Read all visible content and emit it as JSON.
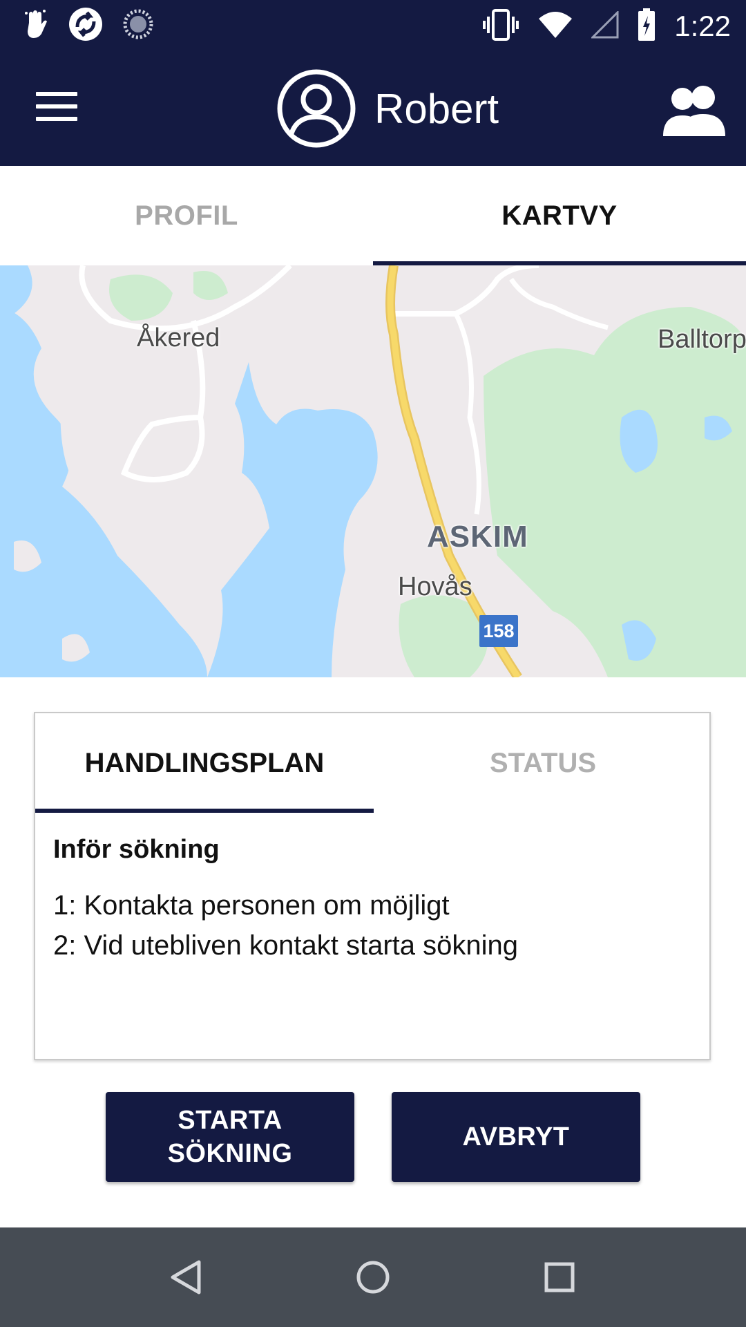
{
  "status_bar": {
    "time": "1:22",
    "left_icons": [
      "hand-wave-icon",
      "circular-arrows-icon",
      "loading-spinner-icon"
    ],
    "right_icons": [
      "vibrate-icon",
      "wifi-icon",
      "signal-icon",
      "battery-charging-icon"
    ]
  },
  "app_bar": {
    "user_name": "Robert",
    "menu_icon": "hamburger-menu-icon",
    "avatar_icon": "user-avatar-icon",
    "group_icon": "group-people-icon"
  },
  "tabs": [
    {
      "label": "PROFIL",
      "active": false
    },
    {
      "label": "KARTVY",
      "active": true
    }
  ],
  "map": {
    "labels": {
      "akered": "Åkered",
      "balltorp": "Balltorp",
      "askim": "ASKIM",
      "hovas": "Hovås"
    },
    "road_badge": "158"
  },
  "card": {
    "tabs": [
      {
        "label": "HANDLINGSPLAN",
        "active": true
      },
      {
        "label": "STATUS",
        "active": false
      }
    ],
    "heading": "Inför sökning",
    "lines": [
      "1: Kontakta personen om möjligt",
      "2: Vid utebliven kontakt starta sökning"
    ]
  },
  "buttons": {
    "start_line1": "STARTA",
    "start_line2": "SÖKNING",
    "cancel": "AVBRYT"
  },
  "nav_bar": [
    "back-icon",
    "home-icon",
    "recents-icon"
  ],
  "colors": {
    "primary": "#141a42",
    "water": "#aadaff",
    "park": "#cdeccf",
    "highway": "#f7d96a"
  }
}
